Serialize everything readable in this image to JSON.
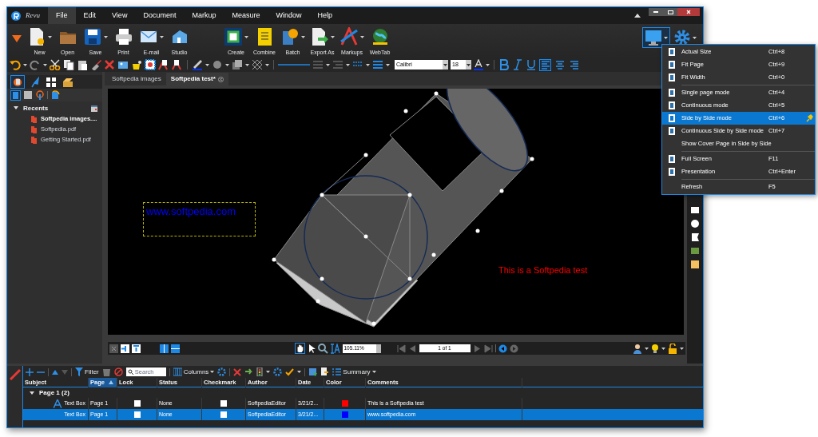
{
  "menu_bar": {
    "logo_text": "Revu",
    "items": [
      {
        "label": "File",
        "selected": true
      },
      {
        "label": "Edit",
        "selected": false
      },
      {
        "label": "View",
        "selected": false
      },
      {
        "label": "Document",
        "selected": false
      },
      {
        "label": "Markup",
        "selected": false
      },
      {
        "label": "Measure",
        "selected": false
      },
      {
        "label": "Window",
        "selected": false
      },
      {
        "label": "Help",
        "selected": false
      }
    ]
  },
  "ribbon": {
    "buttons": [
      {
        "label": "New",
        "dropdown": true
      },
      {
        "label": "Open",
        "dropdown": false
      },
      {
        "label": "Save",
        "dropdown": true
      },
      {
        "label": "Print",
        "dropdown": false
      },
      {
        "label": "E-mail",
        "dropdown": true
      },
      {
        "label": "Studio",
        "dropdown": false
      },
      {
        "label": "Create",
        "dropdown": true
      },
      {
        "label": "Combine",
        "dropdown": false
      },
      {
        "label": "Batch",
        "dropdown": true
      },
      {
        "label": "Export As",
        "dropdown": true
      },
      {
        "label": "Markups",
        "dropdown": true
      },
      {
        "label": "WebTab",
        "dropdown": false
      }
    ],
    "view_button": {
      "selected": true
    }
  },
  "format_toolbar": {
    "font": "Calibri",
    "size": "18",
    "alignment": [
      {
        "selected": true
      },
      {
        "selected": false
      },
      {
        "selected": false
      }
    ]
  },
  "left_panel": {
    "tabs": [
      {
        "selected": true
      },
      {
        "selected": false
      },
      {
        "selected": false
      },
      {
        "selected": false
      }
    ],
    "tree": [
      {
        "label": "Recents",
        "expanded": true,
        "children": [
          {
            "label": "Softpedia images....",
            "current": true
          },
          {
            "label": "Softpedia.pdf",
            "current": false
          },
          {
            "label": "Getting Started.pdf",
            "current": false
          }
        ]
      }
    ]
  },
  "document_tabs": [
    {
      "label": "Softpedia images",
      "selected": false
    },
    {
      "label": "Softpedia test*",
      "selected": true
    }
  ],
  "canvas": {
    "texts": [
      {
        "text": "www.softpedia.com",
        "color": "#0000ff",
        "selected": true
      },
      {
        "text": "This is a Softpedia test",
        "color": "#ff0000",
        "selected": false
      }
    ]
  },
  "navigation_bar": {
    "zoom": "105.11%",
    "page": "1 of 1"
  },
  "view_menu": {
    "groups": [
      [
        {
          "label": "Actual Size",
          "shortcut": "Ctrl+8",
          "icon": true,
          "selected": false,
          "pinned": false
        },
        {
          "label": "Fit Page",
          "shortcut": "Ctrl+9",
          "icon": true,
          "selected": false,
          "pinned": false
        },
        {
          "label": "Fit Width",
          "shortcut": "Ctrl+0",
          "icon": true,
          "selected": false,
          "pinned": false
        }
      ],
      [
        {
          "label": "Single page mode",
          "shortcut": "Ctrl+4",
          "icon": true,
          "selected": false,
          "pinned": false
        },
        {
          "label": "Continuous mode",
          "shortcut": "Ctrl+5",
          "icon": true,
          "selected": false,
          "pinned": false
        },
        {
          "label": "Side by Side mode",
          "shortcut": "Ctrl+6",
          "icon": true,
          "selected": true,
          "pinned": true
        },
        {
          "label": "Continuous Side by Side mode",
          "shortcut": "Ctrl+7",
          "icon": true,
          "selected": false,
          "pinned": false
        },
        {
          "label": "Show Cover Page in Side by Side",
          "icon": false,
          "selected": false,
          "pinned": false
        }
      ],
      [
        {
          "label": "Full Screen",
          "shortcut": "F11",
          "icon": true,
          "selected": false,
          "pinned": false
        },
        {
          "label": "Presentation",
          "shortcut": "Ctrl+Enter",
          "icon": true,
          "selected": false,
          "pinned": false
        }
      ],
      [
        {
          "label": "Refresh",
          "shortcut": "F5",
          "icon": false,
          "selected": false,
          "pinned": false
        }
      ]
    ]
  },
  "markups_toolbar": {
    "filter": "Filter",
    "search_placeholder": "Search",
    "columns": "Columns",
    "summary": "Summary"
  },
  "markups_table": {
    "columns": [
      {
        "label": "Subject",
        "sorted": false
      },
      {
        "label": "Page",
        "sorted": true
      },
      {
        "label": "Lock",
        "sorted": false
      },
      {
        "label": "Status",
        "sorted": false
      },
      {
        "label": "Checkmark",
        "sorted": false
      },
      {
        "label": "Author",
        "sorted": false
      },
      {
        "label": "Date",
        "sorted": false
      },
      {
        "label": "Color",
        "sorted": false
      },
      {
        "label": "Comments",
        "sorted": false
      }
    ],
    "groups": [
      {
        "label": "Page 1 (2)",
        "expanded": true,
        "rows": [
          {
            "subject": "Text Box",
            "icon": true,
            "page": "Page 1",
            "locked": false,
            "status": "None",
            "checkmark": false,
            "author": "SoftpediaEditor",
            "date": "3/21/2...",
            "color": "#ff0000",
            "comments": "This is a Softpedia test",
            "selected": false
          },
          {
            "subject": "Text Box",
            "icon": false,
            "page": "Page 1",
            "locked": false,
            "status": "None",
            "checkmark": false,
            "author": "SoftpediaEditor",
            "date": "3/21/2...",
            "color": "#0000ff",
            "comments": "www.softpedia.com",
            "selected": true
          }
        ]
      }
    ]
  }
}
